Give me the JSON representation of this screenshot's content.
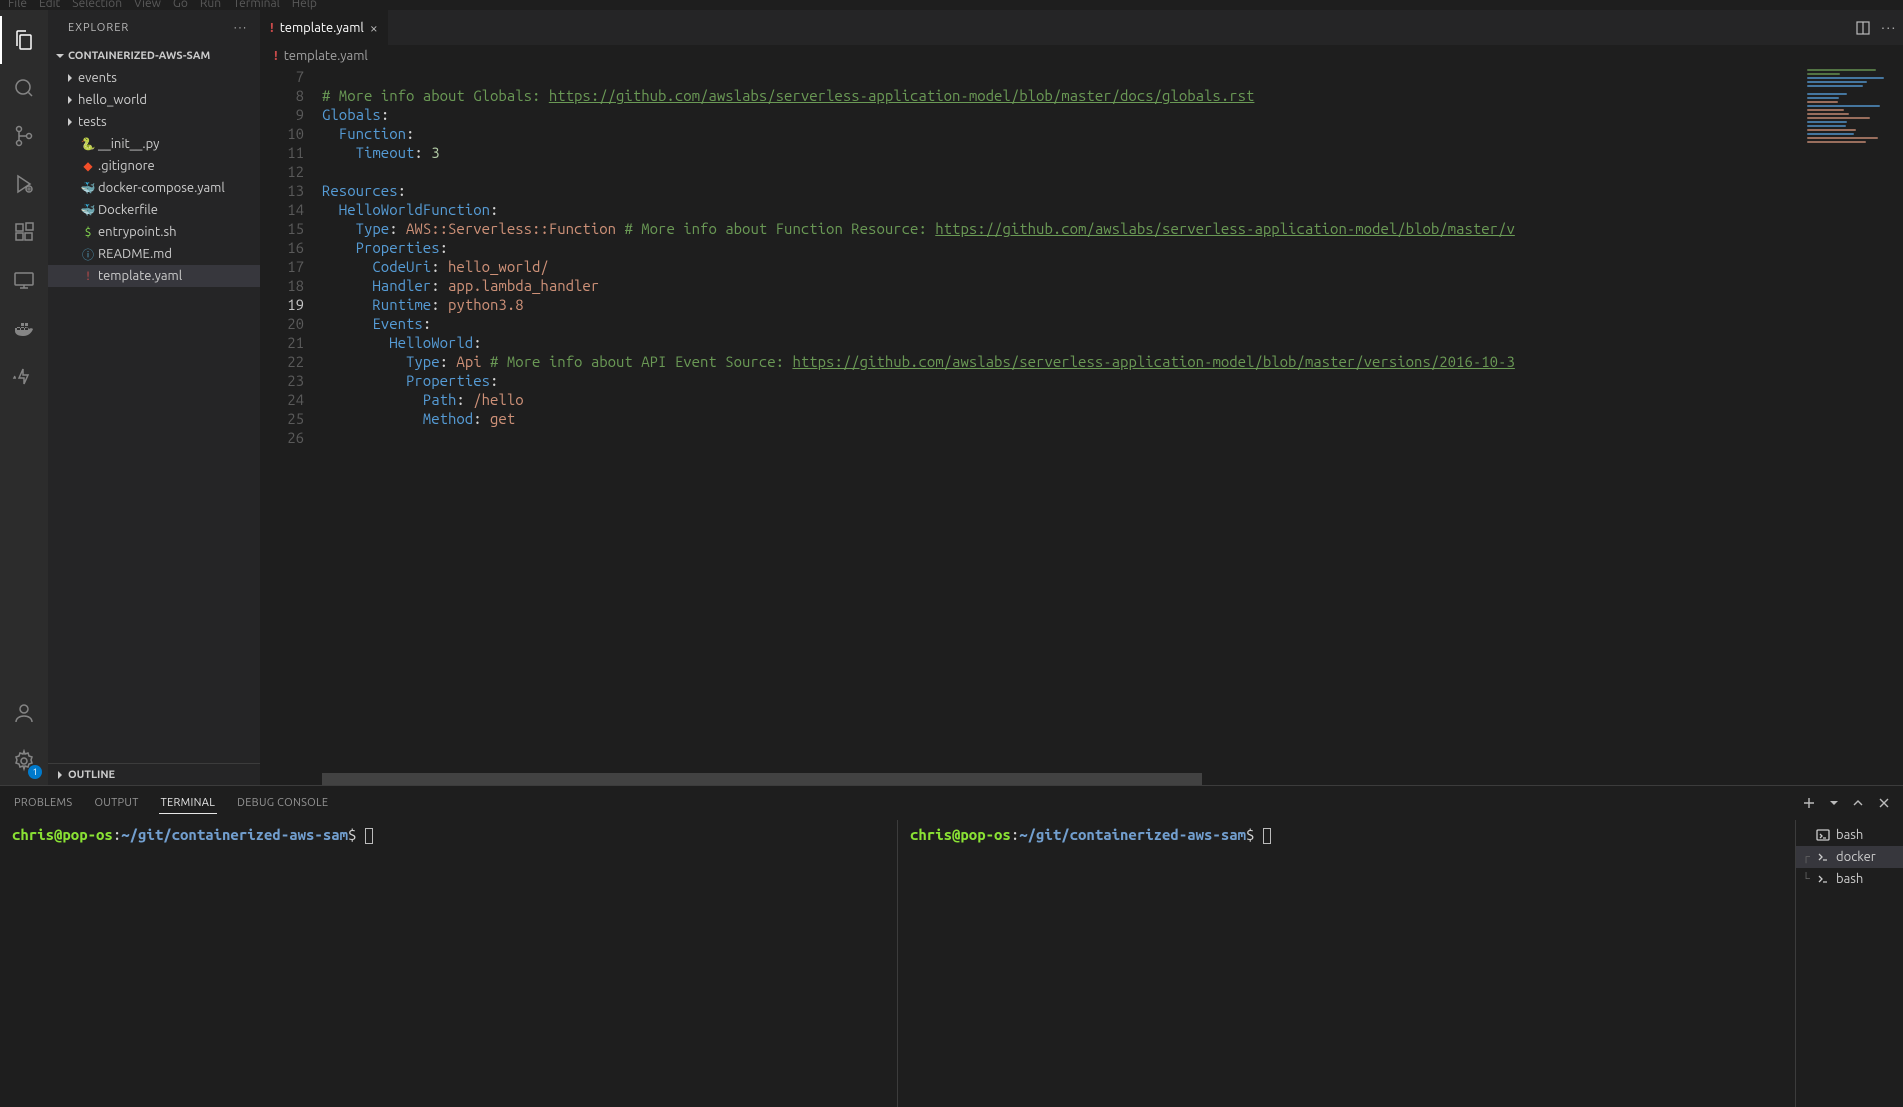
{
  "menubar": [
    "File",
    "Edit",
    "Selection",
    "View",
    "Go",
    "Run",
    "Terminal",
    "Help"
  ],
  "sidebar": {
    "title": "EXPLORER",
    "project": "CONTAINERIZED-AWS-SAM",
    "items": [
      {
        "kind": "folder",
        "name": "events"
      },
      {
        "kind": "folder",
        "name": "hello_world"
      },
      {
        "kind": "folder",
        "name": "tests"
      },
      {
        "kind": "file",
        "name": "__init__.py",
        "icon": "py"
      },
      {
        "kind": "file",
        "name": ".gitignore",
        "icon": "git"
      },
      {
        "kind": "file",
        "name": "docker-compose.yaml",
        "icon": "docker"
      },
      {
        "kind": "file",
        "name": "Dockerfile",
        "icon": "docker"
      },
      {
        "kind": "file",
        "name": "entrypoint.sh",
        "icon": "sh"
      },
      {
        "kind": "file",
        "name": "README.md",
        "icon": "md"
      },
      {
        "kind": "file",
        "name": "template.yaml",
        "icon": "yaml",
        "selected": true
      }
    ],
    "outline": "OUTLINE"
  },
  "tab": {
    "file": "template.yaml",
    "breadcrumb": "template.yaml"
  },
  "editor": {
    "first_line": 7,
    "cursor_line": 19,
    "lines": [
      {
        "n": 7,
        "tokens": []
      },
      {
        "n": 8,
        "tokens": [
          [
            "cmt",
            "# More info about Globals: "
          ],
          [
            "url",
            "https://github.com/awslabs/serverless-application-model/blob/master/docs/globals.rst"
          ]
        ]
      },
      {
        "n": 9,
        "tokens": [
          [
            "key",
            "Globals"
          ],
          [
            "",
            ":"
          ]
        ]
      },
      {
        "n": 10,
        "tokens": [
          [
            "key",
            "  Function"
          ],
          [
            "",
            ":"
          ]
        ]
      },
      {
        "n": 11,
        "tokens": [
          [
            "key",
            "    Timeout"
          ],
          [
            "",
            ": "
          ],
          [
            "num",
            "3"
          ]
        ]
      },
      {
        "n": 12,
        "tokens": []
      },
      {
        "n": 13,
        "tokens": [
          [
            "key",
            "Resources"
          ],
          [
            "",
            ":"
          ]
        ]
      },
      {
        "n": 14,
        "tokens": [
          [
            "key",
            "  HelloWorldFunction"
          ],
          [
            "",
            ":"
          ]
        ]
      },
      {
        "n": 15,
        "tokens": [
          [
            "key",
            "    Type"
          ],
          [
            "",
            ": "
          ],
          [
            "str",
            "AWS::Serverless::Function"
          ],
          [
            "",
            " "
          ],
          [
            "cmt",
            "# More info about Function Resource: "
          ],
          [
            "url",
            "https://github.com/awslabs/serverless-application-model/blob/master/v"
          ]
        ]
      },
      {
        "n": 16,
        "tokens": [
          [
            "key",
            "    Properties"
          ],
          [
            "",
            ":"
          ]
        ]
      },
      {
        "n": 17,
        "tokens": [
          [
            "key",
            "      CodeUri"
          ],
          [
            "",
            ": "
          ],
          [
            "str",
            "hello_world/"
          ]
        ]
      },
      {
        "n": 18,
        "tokens": [
          [
            "key",
            "      Handler"
          ],
          [
            "",
            ": "
          ],
          [
            "str",
            "app.lambda_handler"
          ]
        ]
      },
      {
        "n": 19,
        "tokens": [
          [
            "key",
            "      Runtime"
          ],
          [
            "",
            ": "
          ],
          [
            "str",
            "python3.8"
          ]
        ]
      },
      {
        "n": 20,
        "tokens": [
          [
            "key",
            "      Events"
          ],
          [
            "",
            ":"
          ]
        ]
      },
      {
        "n": 21,
        "tokens": [
          [
            "key",
            "        HelloWorld"
          ],
          [
            "",
            ":"
          ]
        ]
      },
      {
        "n": 22,
        "tokens": [
          [
            "key",
            "          Type"
          ],
          [
            "",
            ": "
          ],
          [
            "str",
            "Api"
          ],
          [
            "",
            " "
          ],
          [
            "cmt",
            "# More info about API Event Source: "
          ],
          [
            "url",
            "https://github.com/awslabs/serverless-application-model/blob/master/versions/2016-10-3"
          ]
        ]
      },
      {
        "n": 23,
        "tokens": [
          [
            "key",
            "          Properties"
          ],
          [
            "",
            ":"
          ]
        ]
      },
      {
        "n": 24,
        "tokens": [
          [
            "key",
            "            Path"
          ],
          [
            "",
            ": "
          ],
          [
            "str",
            "/hello"
          ]
        ]
      },
      {
        "n": 25,
        "tokens": [
          [
            "key",
            "            Method"
          ],
          [
            "",
            ": "
          ],
          [
            "str",
            "get"
          ]
        ]
      },
      {
        "n": 26,
        "tokens": []
      }
    ]
  },
  "panel": {
    "tabs": {
      "problems": "PROBLEMS",
      "output": "OUTPUT",
      "terminal": "TERMINAL",
      "debug": "DEBUG CONSOLE"
    },
    "terminals": [
      {
        "name": "bash",
        "icon": "bash"
      },
      {
        "name": "docker",
        "icon": "shell",
        "group": "start"
      },
      {
        "name": "bash",
        "icon": "shell",
        "group": "end"
      }
    ],
    "prompt": {
      "user": "chris",
      "host": "pop-os",
      "path": "~/git/containerized-aws-sam",
      "symbol": "$"
    }
  },
  "settings_badge": "1"
}
